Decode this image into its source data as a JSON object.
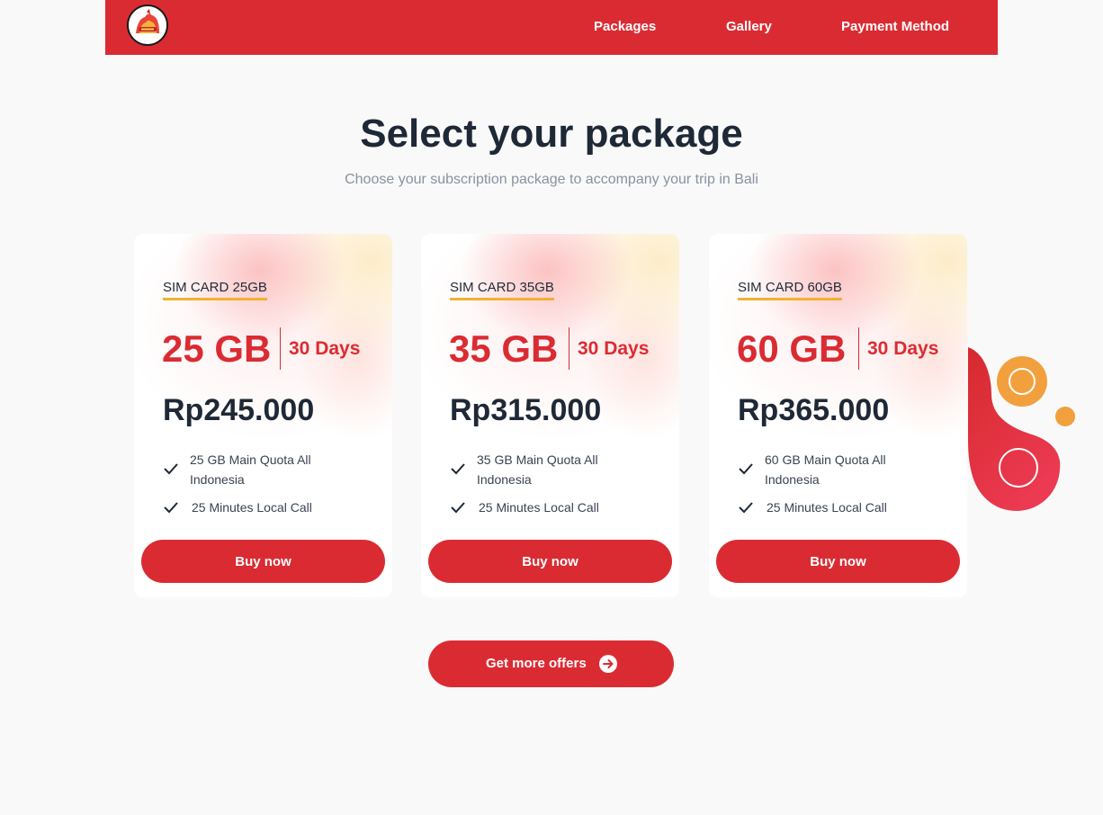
{
  "nav": {
    "logo_alt": "Bali SIM logo",
    "links": [
      "Packages",
      "Gallery",
      "Payment Method"
    ]
  },
  "hero": {
    "title": "Select your package",
    "subtitle": "Choose your subscription package to accompany your trip in Bali"
  },
  "packages": [
    {
      "name": "SIM CARD 25GB",
      "quota": "25 GB",
      "duration": "30 Days",
      "price": "Rp245.000",
      "features": [
        "25 GB Main Quota All Indonesia",
        "25 Minutes Local Call"
      ],
      "button": "Buy now"
    },
    {
      "name": "SIM CARD 35GB",
      "quota": "35 GB",
      "duration": "30 Days",
      "price": "Rp315.000",
      "features": [
        "35 GB Main Quota All Indonesia",
        "25 Minutes Local Call"
      ],
      "button": "Buy now"
    },
    {
      "name": "SIM CARD 60GB",
      "quota": "60 GB",
      "duration": "30 Days",
      "price": "Rp365.000",
      "features": [
        "60 GB Main Quota All Indonesia",
        "25 Minutes Local Call"
      ],
      "button": "Buy now"
    }
  ],
  "more_offers": {
    "label": "Get more offers",
    "icon": "arrow-right-circle-icon"
  },
  "colors": {
    "brand_red": "#db2b32",
    "accent_yellow": "#f0b232",
    "accent_orange": "#f2a03d",
    "text_dark": "#1e2836",
    "text_muted": "#8a92a0"
  }
}
